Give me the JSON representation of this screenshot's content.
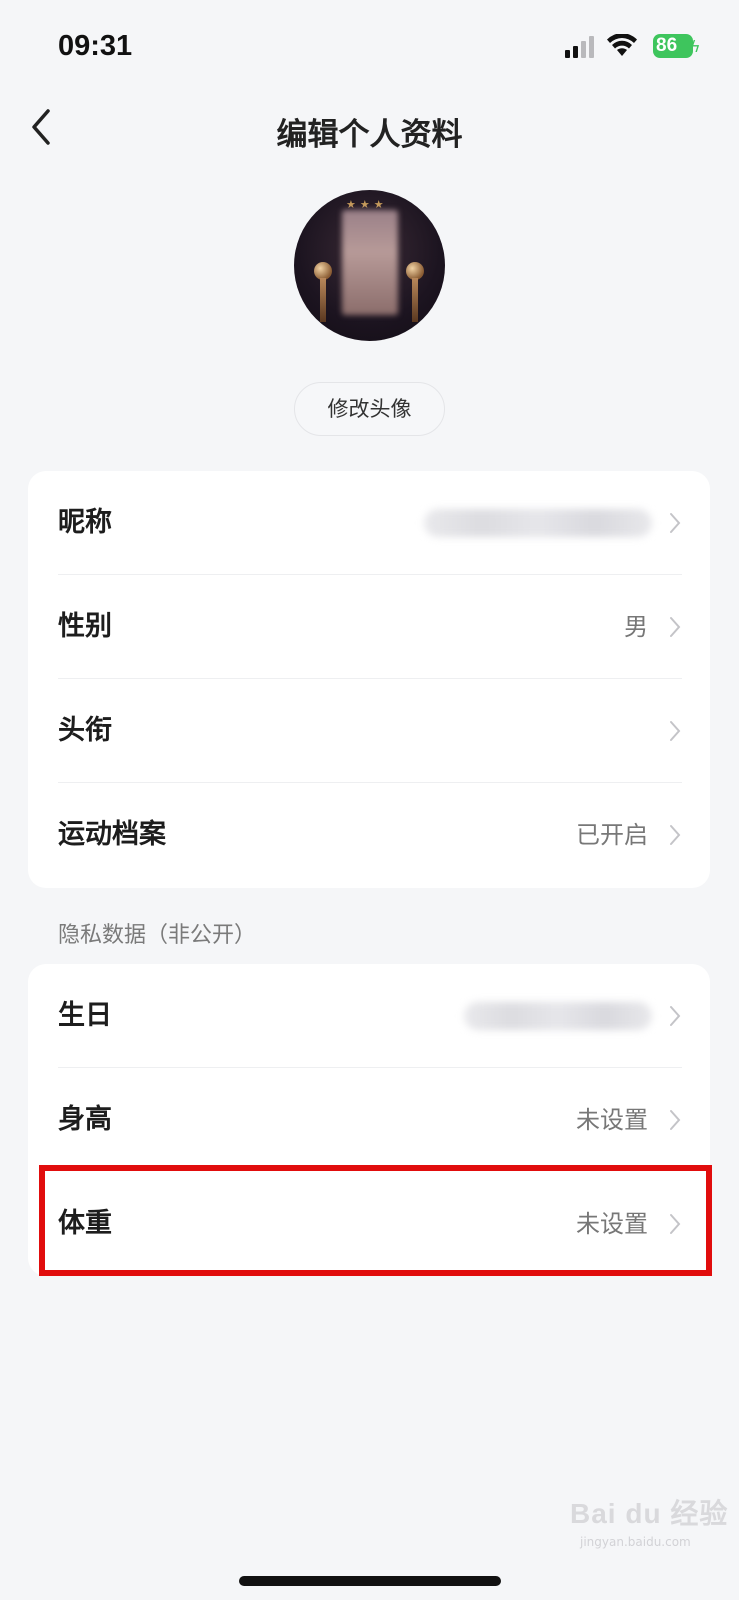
{
  "status_bar": {
    "time": "09:31",
    "battery": "86"
  },
  "header": {
    "title": "编辑个人资料"
  },
  "avatar": {
    "change_label": "修改头像"
  },
  "public_profile": {
    "rows": [
      {
        "label": "昵称",
        "value": ""
      },
      {
        "label": "性别",
        "value": "男"
      },
      {
        "label": "头衔",
        "value": ""
      },
      {
        "label": "运动档案",
        "value": "已开启"
      }
    ]
  },
  "private_section": {
    "header": "隐私数据（非公开）",
    "rows": [
      {
        "label": "生日",
        "value": ""
      },
      {
        "label": "身高",
        "value": "未设置"
      },
      {
        "label": "体重",
        "value": "未设置"
      }
    ]
  },
  "highlight_color": "#e10d0d",
  "watermark": {
    "text": "Bai du 经验",
    "sub": "jingyan.baidu.com"
  }
}
